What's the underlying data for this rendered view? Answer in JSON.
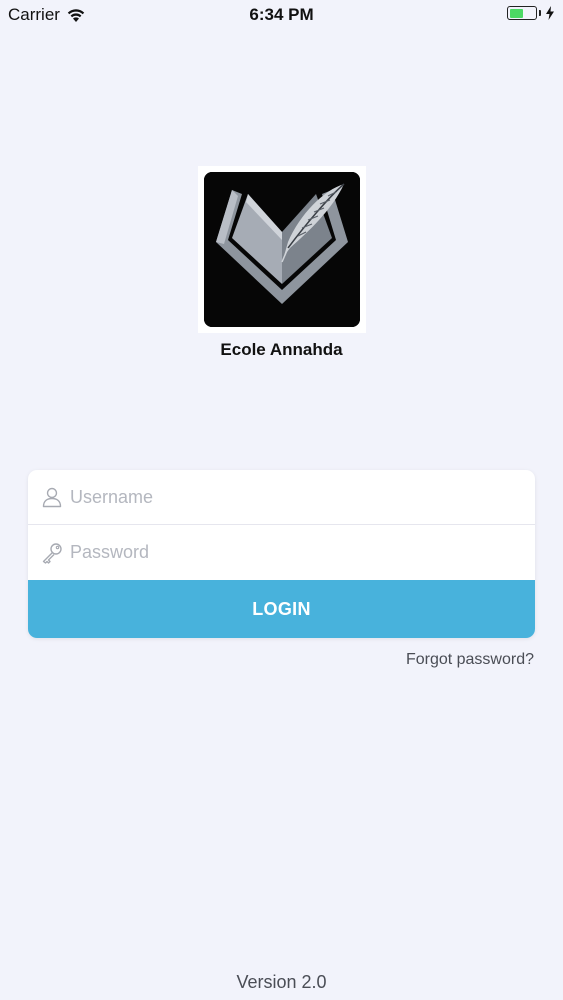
{
  "status_bar": {
    "carrier": "Carrier",
    "time": "6:34 PM",
    "battery_color": "#4cd964",
    "battery_level": 0.55
  },
  "logo": {
    "icon": "book-quill-logo",
    "name": "Ecole Annahda"
  },
  "login": {
    "username_placeholder": "Username",
    "password_placeholder": "Password",
    "username_icon": "user-icon",
    "password_icon": "key-icon",
    "button_label": "LOGIN",
    "button_color": "#48b2dc",
    "forgot_label": "Forgot password?"
  },
  "footer": {
    "version": "Version 2.0"
  }
}
